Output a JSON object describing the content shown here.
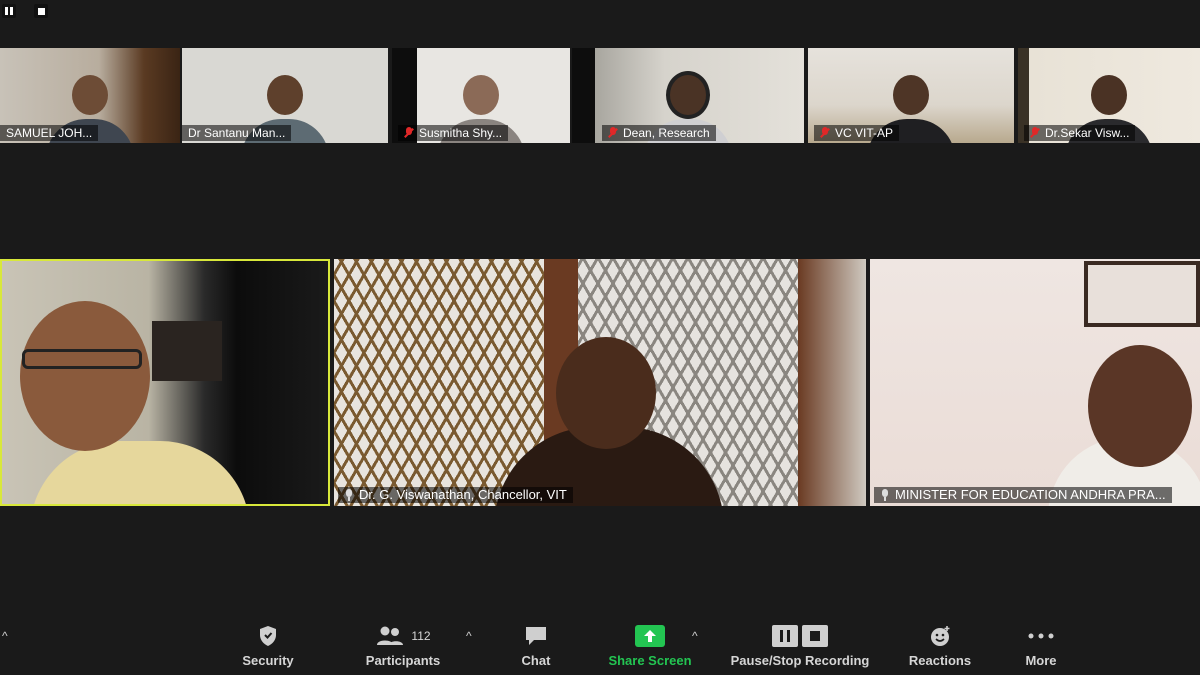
{
  "participants_strip": [
    {
      "name": "SAMUEL JOH...",
      "muted": false
    },
    {
      "name": "Dr Santanu Man...",
      "muted": false
    },
    {
      "name": "Susmitha Shy...",
      "muted": true
    },
    {
      "name": "Dean, Research",
      "muted": true
    },
    {
      "name": "VC VIT-AP",
      "muted": true
    },
    {
      "name": "Dr.Sekar Visw...",
      "muted": true
    }
  ],
  "main_tiles": [
    {
      "name": "",
      "active_speaker": true
    },
    {
      "name": "Dr. G. Viswanathan, Chancellor, VIT"
    },
    {
      "name": "MINISTER FOR EDUCATION ANDHRA PRA..."
    }
  ],
  "toolbar": {
    "security": "Security",
    "participants": "Participants",
    "participant_count": "112",
    "chat": "Chat",
    "share_screen": "Share Screen",
    "recording": "Pause/Stop Recording",
    "reactions": "Reactions",
    "more": "More"
  },
  "colors": {
    "background": "#1a1a1a",
    "active_speaker_border": "#d8e83a",
    "share_screen_green": "#23c552",
    "muted_red": "#e02828"
  }
}
